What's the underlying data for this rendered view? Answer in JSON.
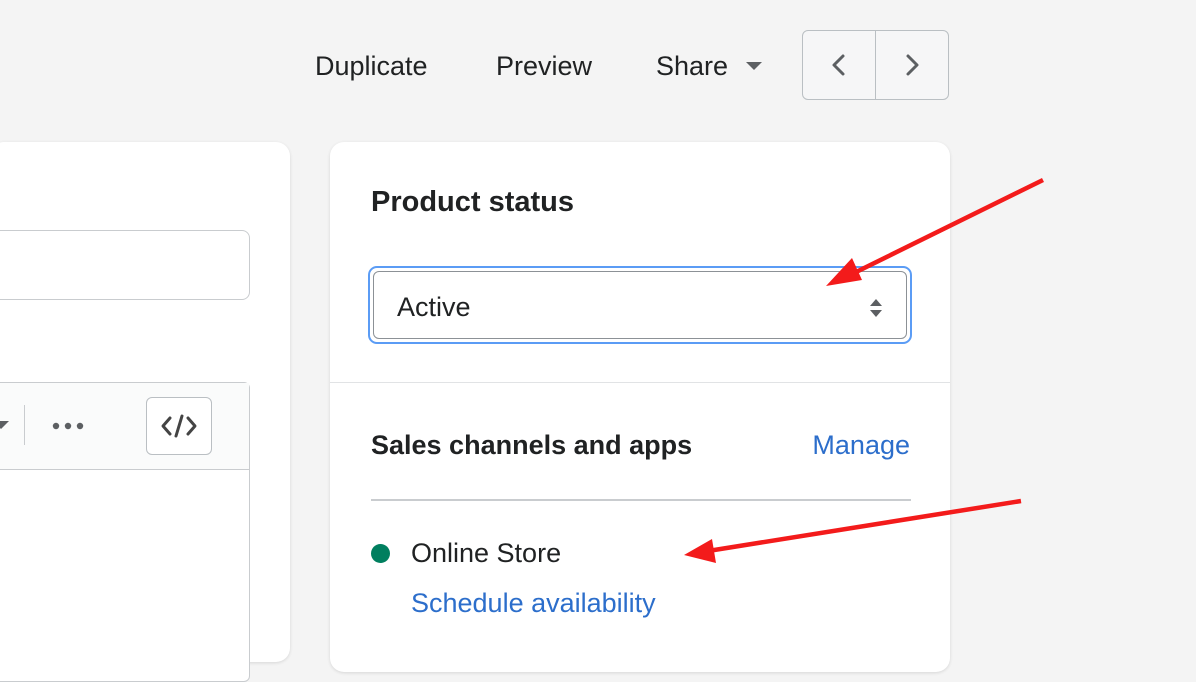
{
  "toolbar": {
    "duplicate_label": "Duplicate",
    "preview_label": "Preview",
    "share_label": "Share"
  },
  "product_status": {
    "title": "Product status",
    "selected": "Active"
  },
  "sales_channels": {
    "title": "Sales channels and apps",
    "manage_label": "Manage",
    "channels": [
      {
        "name": "Online Store",
        "status_color": "#007f5f",
        "schedule_label": "Schedule availability"
      }
    ]
  },
  "colors": {
    "link": "#2c6ecb",
    "focus_ring": "#5b9cf5",
    "annotation_arrow": "#f31b1b",
    "page_background": "#f4f4f4"
  },
  "icons": [
    "chevron-left-icon",
    "chevron-right-icon",
    "caret-down-icon",
    "horizontal-dots-icon",
    "code-icon",
    "select-arrows-icon",
    "red-arrow"
  ]
}
